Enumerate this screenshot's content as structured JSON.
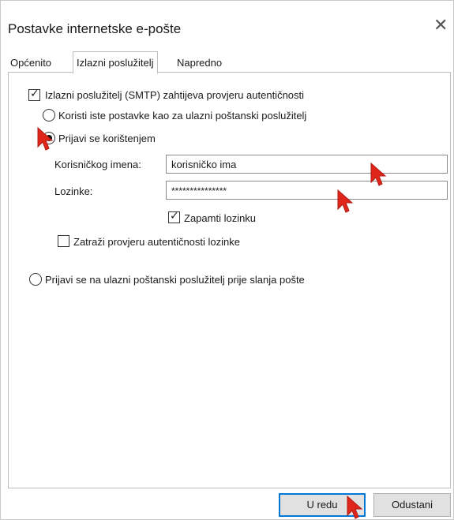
{
  "dialog": {
    "title": "Postavke internetske e-pošte",
    "close_glyph": "✕"
  },
  "tabs": [
    {
      "label": "Općenito",
      "active": false
    },
    {
      "label": "Izlazni poslužitelj",
      "active": true
    },
    {
      "label": "Napredno",
      "active": false
    }
  ],
  "outgoing": {
    "smtp_auth_label": "Izlazni poslužitelj (SMTP) zahtijeva provjeru autentičnosti",
    "smtp_auth_checked": true,
    "same_settings_label": "Koristi iste postavke kao za ulazni poštanski poslužitelj",
    "same_settings_selected": false,
    "login_with_label": "Prijavi se korištenjem",
    "login_with_selected": true,
    "username_label": "Korisničkog imena:",
    "username_value": "korisničko ima",
    "password_label": "Lozinke:",
    "password_value": "***************",
    "remember_password_label": "Zapamti lozinku",
    "remember_password_checked": true,
    "spa_label": "Zatraži provjeru autentičnosti lozinke",
    "spa_checked": false,
    "login_before_send_label": "Prijavi se na ulazni poštanski poslužitelj prije slanja pošte",
    "login_before_send_selected": false
  },
  "buttons": {
    "ok_label": "U redu",
    "cancel_label": "Odustani"
  },
  "colors": {
    "cursor_red": "#e0261b",
    "default_button_border": "#0078d7"
  }
}
